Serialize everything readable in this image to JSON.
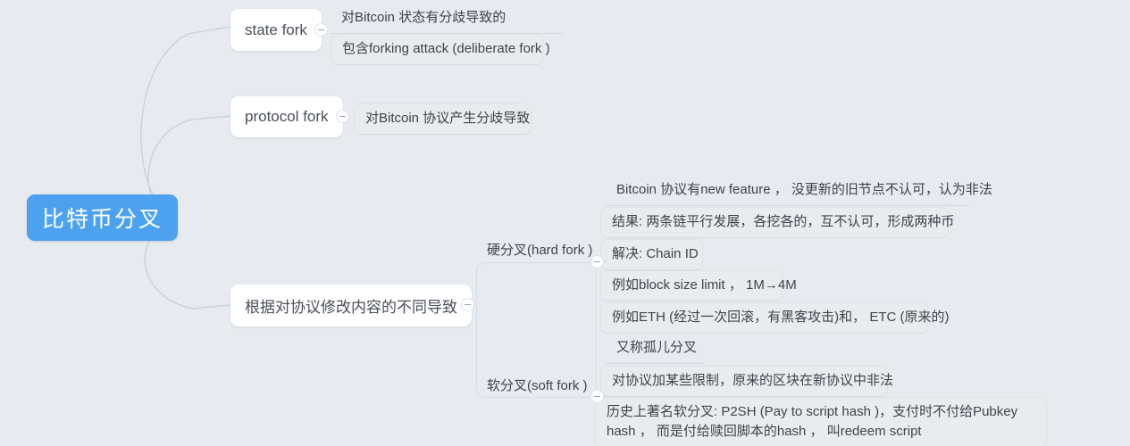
{
  "theme": {
    "background": "#e7eaee",
    "root_fill": "#4da2f0",
    "root_text": "#ffffff",
    "branch_fill": "#ffffff",
    "branch_text": "#4a4f57",
    "leaf_text": "#3f444b",
    "link_color": "#c9d0d8",
    "underline_color": "#d5dae1"
  },
  "root": {
    "label": "比特币分叉"
  },
  "branches": [
    {
      "id": "state-fork",
      "label": "state fork",
      "toggle": "−",
      "children": [
        {
          "label": "对Bitcoin 状态有分歧导致的"
        },
        {
          "label": "包含forking attack (deliberate fork )"
        }
      ]
    },
    {
      "id": "protocol-fork",
      "label": "protocol fork",
      "toggle": "−",
      "children": [
        {
          "label": "对Bitcoin 协议产生分歧导致"
        }
      ]
    },
    {
      "id": "modify-content",
      "label": "根据对协议修改内容的不同导致",
      "toggle": "−",
      "children": [
        {
          "id": "hard-fork",
          "label": "硬分叉(hard fork )",
          "toggle": "−",
          "children": [
            {
              "label": "Bitcoin 协议有new feature ， 没更新的旧节点不认可，认为非法"
            },
            {
              "label": "结果: 两条链平行发展，各挖各的，互不认可，形成两种币"
            },
            {
              "label": "解决: Chain ID"
            },
            {
              "label": "例如block size limit ， 1M→4M"
            },
            {
              "label": "例如ETH (经过一次回滚，有黑客攻击)和， ETC (原来的)"
            }
          ]
        },
        {
          "id": "soft-fork",
          "label": "软分叉(soft fork )",
          "toggle": "−",
          "children": [
            {
              "label": "又称孤儿分叉"
            },
            {
              "label": "对协议加某些限制，原来的区块在新协议中非法"
            },
            {
              "label": "历史上著名软分叉: P2SH (Pay to script hash )，支付时不付给Pubkey hash ， 而是付给赎回脚本的hash ， 叫redeem script"
            }
          ]
        }
      ]
    }
  ]
}
